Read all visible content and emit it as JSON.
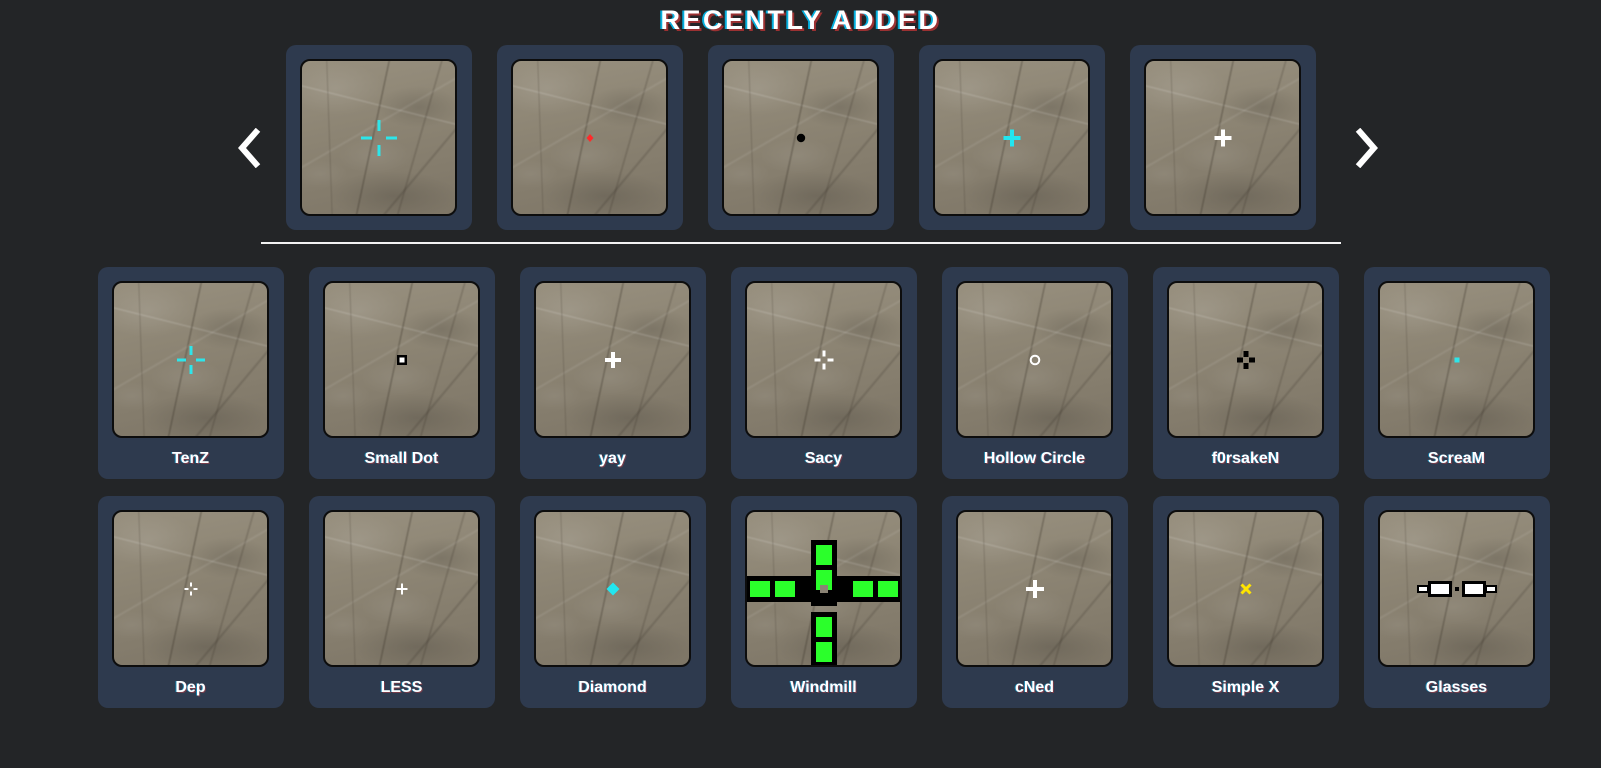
{
  "header": {
    "title": "RECENTLY ADDED"
  },
  "carousel": {
    "prev_label": "Previous",
    "next_label": "Next",
    "prev_icon": "chevron-left-icon",
    "next_icon": "chevron-right-icon",
    "items": [
      {
        "name": "",
        "crosshair": "cyan-gapped-cross",
        "color": "#2de5ea"
      },
      {
        "name": "",
        "crosshair": "tiny-red-diamond",
        "color": "#ff2a2a"
      },
      {
        "name": "",
        "crosshair": "black-dot",
        "color": "#000000"
      },
      {
        "name": "",
        "crosshair": "cyan-small-plus",
        "color": "#22e6f0"
      },
      {
        "name": "",
        "crosshair": "white-small-plus",
        "color": "#ffffff"
      }
    ]
  },
  "grid": {
    "rows": [
      [
        {
          "name": "TenZ",
          "crosshair": "cyan-gapped-cross",
          "color": "#2de5ea"
        },
        {
          "name": "Small Dot",
          "crosshair": "white-dot-outline",
          "color": "#ffffff"
        },
        {
          "name": "yay",
          "crosshair": "white-small-plus",
          "color": "#ffffff"
        },
        {
          "name": "Sacy",
          "crosshair": "white-gapped-cross",
          "color": "#ffffff"
        },
        {
          "name": "Hollow Circle",
          "crosshair": "white-hollow-circle",
          "color": "#ffffff"
        },
        {
          "name": "f0rsakeN",
          "crosshair": "black-thick-gapped-cross",
          "color": "#000000"
        },
        {
          "name": "ScreaM",
          "crosshair": "cyan-tiny-dot",
          "color": "#2de5ea"
        }
      ],
      [
        {
          "name": "Dep",
          "crosshair": "white-tiny-gapped-cross",
          "color": "#ffffff"
        },
        {
          "name": "LESS",
          "crosshair": "white-tiny-plus",
          "color": "#ffffff"
        },
        {
          "name": "Diamond",
          "crosshair": "cyan-diamond",
          "color": "#22e6f0"
        },
        {
          "name": "Windmill",
          "crosshair": "green-segmented-cross",
          "color": "#2bff2b"
        },
        {
          "name": "cNed",
          "crosshair": "white-small-plus",
          "color": "#ffffff"
        },
        {
          "name": "Simple X",
          "crosshair": "yellow-x",
          "color": "#ffe400"
        },
        {
          "name": "Glasses",
          "crosshair": "black-glasses",
          "color": "#000000"
        }
      ]
    ]
  },
  "theme": {
    "page_background": "#232527",
    "card_background": "#2e3a4e",
    "thumbnail_background": "#8c8475",
    "text_color": "#ffffff",
    "divider_color": "#f2f2f2"
  }
}
